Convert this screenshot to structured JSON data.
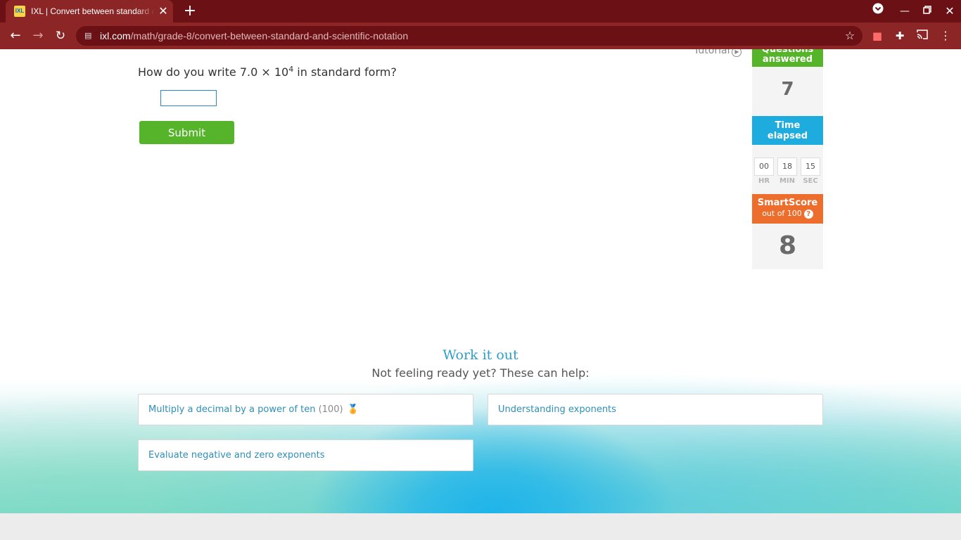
{
  "browser": {
    "tab_title": "IXL | Convert between standard and scientific notation",
    "favicon_text": "IXL",
    "url_host": "ixl.com",
    "url_path": "/math/grade-8/convert-between-standard-and-scientific-notation"
  },
  "page": {
    "tutorial_label": "Tutorial",
    "question": {
      "prefix": "How do you write 7.0 × 10",
      "exponent": "4",
      "suffix": " in standard form?"
    },
    "answer_value": "",
    "submit_label": "Submit"
  },
  "sidebar": {
    "questions_answered": {
      "label_line1": "Questions",
      "label_line2": "answered",
      "value": "7"
    },
    "time_elapsed": {
      "label_line1": "Time",
      "label_line2": "elapsed",
      "hours": "00",
      "minutes": "18",
      "seconds": "15",
      "hours_label": "HR",
      "minutes_label": "MIN",
      "seconds_label": "SEC"
    },
    "smartscore": {
      "title": "SmartScore",
      "subtitle": "out of 100",
      "help": "?",
      "value": "8"
    }
  },
  "work_it_out": {
    "title": "Work it out",
    "subtitle": "Not feeling ready yet? These can help:",
    "cards": [
      {
        "label": "Multiply a decimal by a power of ten",
        "score": "(100)",
        "medal": "medal-icon"
      },
      {
        "label": "Understanding exponents"
      },
      {
        "label": "Evaluate negative and zero exponents"
      }
    ]
  },
  "colors": {
    "chrome_dark": "#6b1014",
    "chrome": "#8c2626",
    "green": "#56b42a",
    "blue": "#1eacdf",
    "orange": "#ec6d2c",
    "link": "#2e8fb8"
  }
}
